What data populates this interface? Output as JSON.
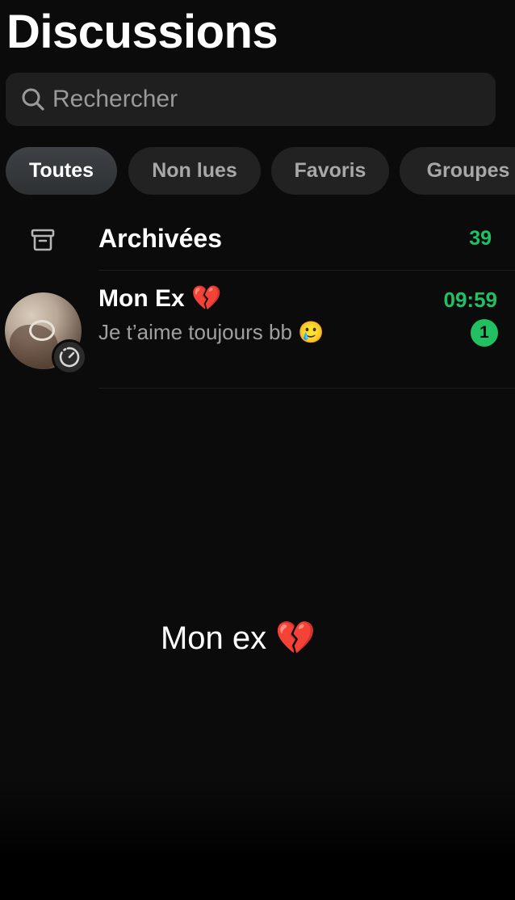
{
  "header": {
    "title": "Discussions"
  },
  "search": {
    "placeholder": "Rechercher",
    "icon": "search-icon"
  },
  "filters": [
    {
      "label": "Toutes",
      "active": true
    },
    {
      "label": "Non lues",
      "active": false
    },
    {
      "label": "Favoris",
      "active": false
    },
    {
      "label": "Groupes",
      "active": false
    }
  ],
  "archived": {
    "label": "Archivées",
    "count": "39",
    "icon": "archive-icon"
  },
  "chats": [
    {
      "name": "Mon Ex 💔",
      "last_message": "Je t’aime toujours bb 🥲",
      "time": "09:59",
      "unread": "1",
      "status_icon": "status-ring-icon"
    }
  ],
  "overlay": {
    "caption": "Mon ex 💔"
  },
  "colors": {
    "accent": "#21c063",
    "background": "#0b0b0b",
    "chip": "#222222",
    "search": "#1f1f1f"
  }
}
